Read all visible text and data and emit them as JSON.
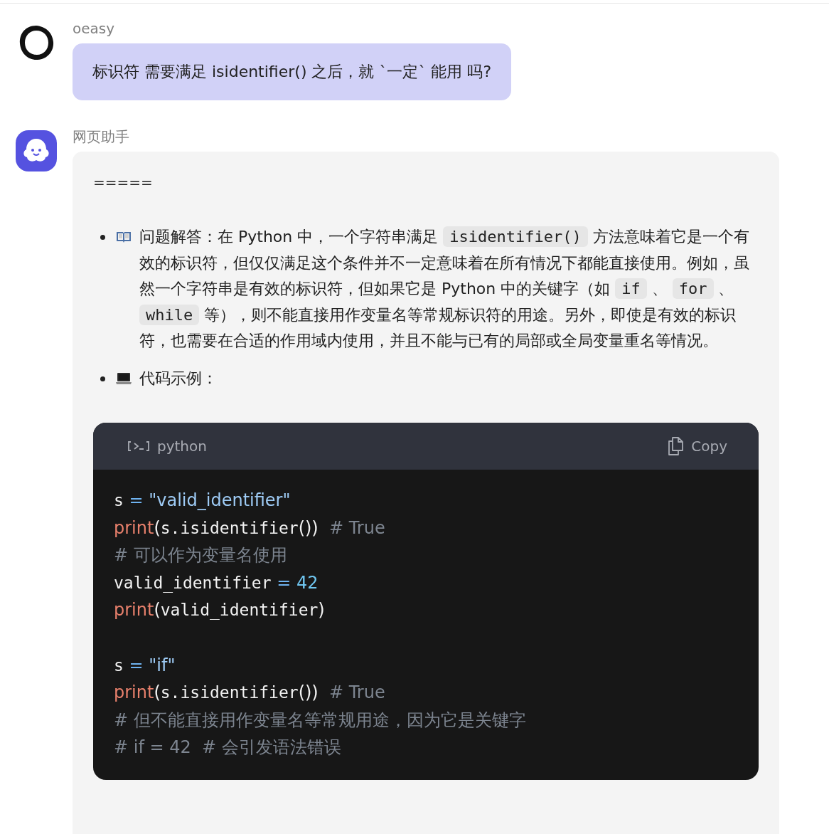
{
  "messages": [
    {
      "kind": "user",
      "author": "oeasy",
      "text": "标识符 需要满足 isidentifier() 之后，就 `一定` 能用 吗?"
    },
    {
      "kind": "assistant",
      "author": "网页助手",
      "preface": "=====",
      "bullets": [
        {
          "kind": "book",
          "segments": [
            {
              "kind": "text",
              "text": "问题解答：在 Python 中，一个字符串满足 "
            },
            {
              "kind": "code",
              "text": "isidentifier()"
            },
            {
              "kind": "text",
              "text": " 方法意味着它是一个有效的标识符，但仅仅满足这个条件并不一定意味着在所有情况下都能直接使用。例如，虽然一个字符串是有效的标识符，但如果它是 Python 中的关键字（如 "
            },
            {
              "kind": "code",
              "text": "if"
            },
            {
              "kind": "text",
              "text": " 、 "
            },
            {
              "kind": "code",
              "text": "for"
            },
            {
              "kind": "text",
              "text": " 、 "
            },
            {
              "kind": "code",
              "text": "while"
            },
            {
              "kind": "text",
              "text": " 等），则不能直接用作变量名等常规标识符的用途。另外，即使是有效的标识符，也需要在合适的作用域内使用，并且不能与已有的局部或全局变量重名等情况。"
            }
          ]
        },
        {
          "kind": "laptop",
          "segments": [
            {
              "kind": "text",
              "text": "代码示例："
            }
          ]
        }
      ],
      "code": {
        "language": "python",
        "copy_label": "Copy",
        "lines": [
          {
            "kind": "code",
            "tokens": [
              {
                "kind": "name",
                "text": "s"
              },
              {
                "kind": "op",
                "text": " = "
              },
              {
                "kind": "string",
                "text": "\"valid_identifier\""
              }
            ]
          },
          {
            "kind": "code",
            "tokens": [
              {
                "kind": "func",
                "text": "print"
              },
              {
                "kind": "punct",
                "text": "("
              },
              {
                "kind": "name",
                "text": "s.isidentifier"
              },
              {
                "kind": "punct",
                "text": "())"
              },
              {
                "kind": "comment",
                "text": "  # True"
              }
            ]
          },
          {
            "kind": "code",
            "tokens": [
              {
                "kind": "comment",
                "text": "# 可以作为变量名使用"
              }
            ]
          },
          {
            "kind": "code",
            "tokens": [
              {
                "kind": "name",
                "text": "valid_identifier"
              },
              {
                "kind": "op",
                "text": " = "
              },
              {
                "kind": "number",
                "text": "42"
              }
            ]
          },
          {
            "kind": "code",
            "tokens": [
              {
                "kind": "func",
                "text": "print"
              },
              {
                "kind": "punct",
                "text": "("
              },
              {
                "kind": "name",
                "text": "valid_identifier"
              },
              {
                "kind": "punct",
                "text": ")"
              }
            ]
          },
          {
            "kind": "blank"
          },
          {
            "kind": "code",
            "tokens": [
              {
                "kind": "name",
                "text": "s"
              },
              {
                "kind": "op",
                "text": " = "
              },
              {
                "kind": "string",
                "text": "\"if\""
              }
            ]
          },
          {
            "kind": "code",
            "tokens": [
              {
                "kind": "func",
                "text": "print"
              },
              {
                "kind": "punct",
                "text": "("
              },
              {
                "kind": "name",
                "text": "s.isidentifier"
              },
              {
                "kind": "punct",
                "text": "())"
              },
              {
                "kind": "comment",
                "text": "  # True"
              }
            ]
          },
          {
            "kind": "code",
            "tokens": [
              {
                "kind": "comment",
                "text": "# 但不能直接用作变量名等常规用途，因为它是关键字"
              }
            ]
          },
          {
            "kind": "code",
            "tokens": [
              {
                "kind": "comment",
                "text": "# if = 42  # 会引发语法错误"
              }
            ]
          }
        ]
      }
    }
  ]
}
